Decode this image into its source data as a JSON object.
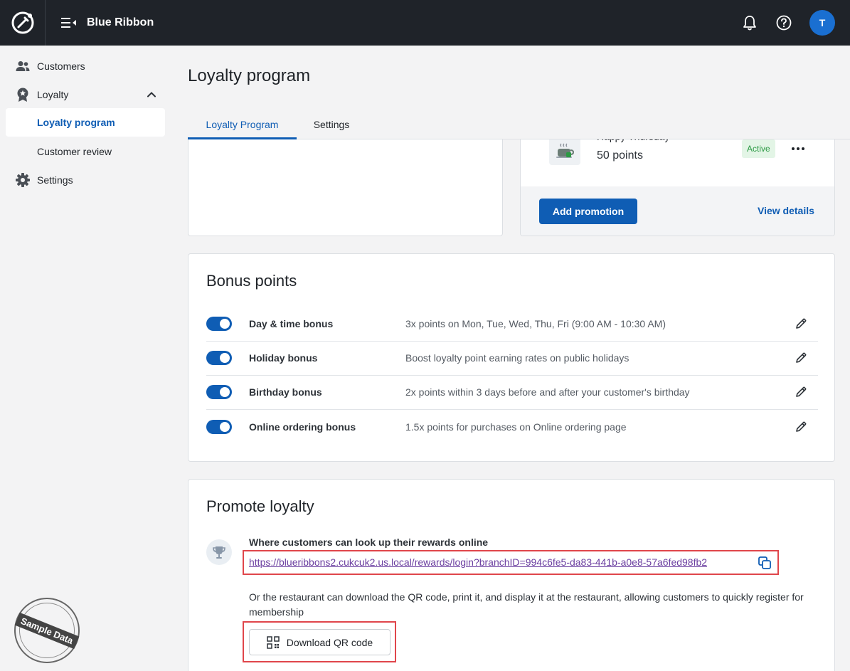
{
  "app": {
    "brand": "Blue Ribbon",
    "avatar_initial": "T"
  },
  "sidebar": {
    "items": [
      {
        "label": "Customers"
      },
      {
        "label": "Loyalty"
      },
      {
        "label": "Loyalty program"
      },
      {
        "label": "Customer review"
      },
      {
        "label": "Settings"
      }
    ],
    "stamp": "Sample Data"
  },
  "page": {
    "title": "Loyalty program",
    "tabs": [
      {
        "label": "Loyalty Program"
      },
      {
        "label": "Settings"
      }
    ]
  },
  "promotion": {
    "name": "Happy Thursday",
    "points": "50 points",
    "status": "Active",
    "add_button": "Add promotion",
    "view_link": "View details"
  },
  "bonus": {
    "title": "Bonus points",
    "items": [
      {
        "name": "Day & time bonus",
        "desc": "3x points on Mon, Tue, Wed, Thu, Fri (9:00 AM - 10:30 AM)"
      },
      {
        "name": "Holiday bonus",
        "desc": "Boost loyalty point earning rates on public holidays"
      },
      {
        "name": "Birthday bonus",
        "desc": "2x points within 3 days before and after your customer's birthday"
      },
      {
        "name": "Online ordering bonus",
        "desc": "1.5x points for purchases on Online ordering page"
      }
    ]
  },
  "promote": {
    "title": "Promote loyalty",
    "lookup_label": "Where customers can look up their rewards online",
    "url": "https://blueribbons2.cukcuk2.us.local/rewards/login?branchID=994c6fe5-da83-441b-a0e8-57a6fed98fb2",
    "qr_desc": "Or the restaurant can download the QR code, print it, and display it at the restaurant, allowing customers to quickly register for membership",
    "qr_button": "Download QR code"
  },
  "colors": {
    "primary": "#0f5db4",
    "topbar": "#1f2329",
    "highlight": "#e0464b",
    "active_badge": "#2c9a44"
  }
}
